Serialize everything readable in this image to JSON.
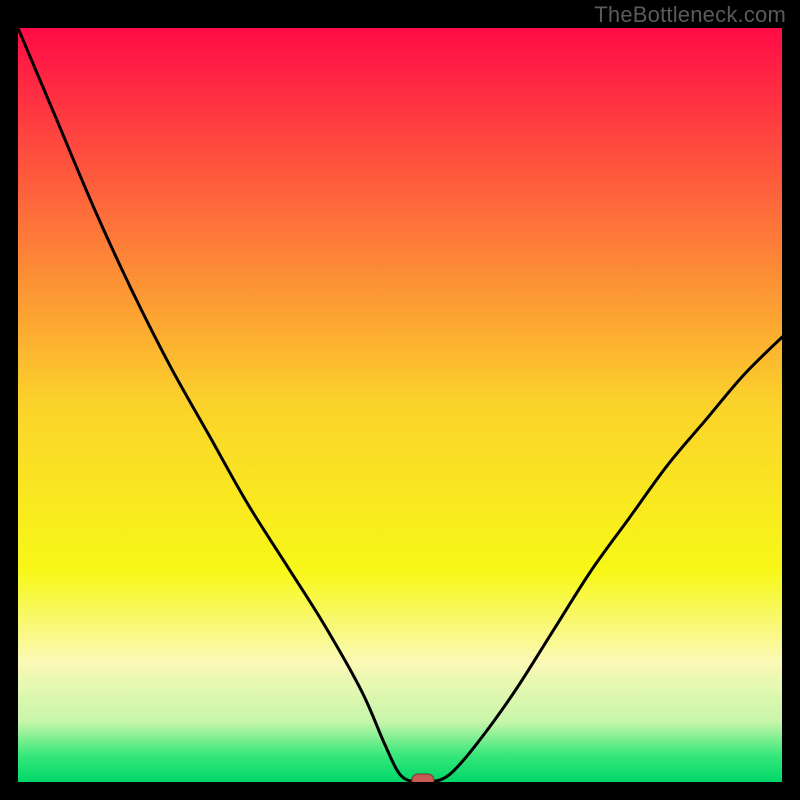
{
  "watermark": "TheBottleneck.com",
  "chart_data": {
    "type": "line",
    "title": "",
    "xlabel": "",
    "ylabel": "",
    "xlim": [
      0,
      100
    ],
    "ylim": [
      0,
      100
    ],
    "series": [
      {
        "name": "bottleneck-curve",
        "x": [
          0,
          5,
          10,
          15,
          20,
          25,
          30,
          35,
          40,
          45,
          48,
          50,
          52,
          54,
          56.5,
          60,
          65,
          70,
          75,
          80,
          85,
          90,
          95,
          100
        ],
        "y": [
          100,
          88,
          76,
          65,
          55,
          46,
          37,
          29,
          21,
          12,
          5,
          1,
          0,
          0,
          1,
          5,
          12,
          20,
          28,
          35,
          42,
          48,
          54,
          59
        ]
      }
    ],
    "minimum_marker": {
      "x": 53,
      "y": 0
    },
    "gradient_stops": [
      {
        "offset": 0.0,
        "color": "#ff0b46"
      },
      {
        "offset": 0.25,
        "color": "#fd6f3a"
      },
      {
        "offset": 0.5,
        "color": "#fbd32b"
      },
      {
        "offset": 0.72,
        "color": "#f8f818"
      },
      {
        "offset": 0.84,
        "color": "#faf9b5"
      },
      {
        "offset": 0.92,
        "color": "#c7f6aa"
      },
      {
        "offset": 0.965,
        "color": "#36e77a"
      },
      {
        "offset": 1.0,
        "color": "#00d768"
      }
    ],
    "colors": {
      "curve": "#000000",
      "marker_fill": "#c85a54",
      "marker_stroke": "#7d312e",
      "frame": "#000000"
    }
  }
}
